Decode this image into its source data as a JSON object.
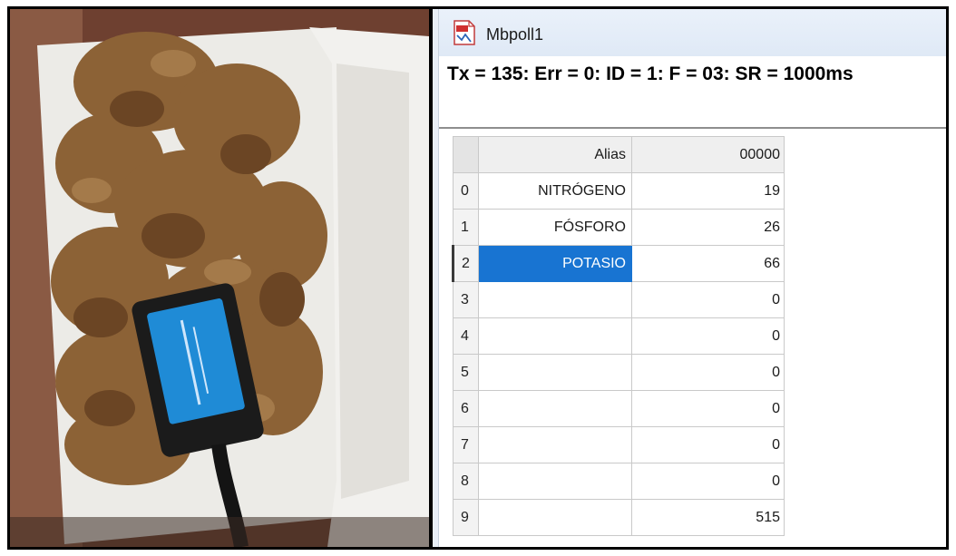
{
  "window": {
    "title": "Mbpoll1",
    "status_line": "Tx = 135: Err = 0: ID = 1: F = 03: SR = 1000ms"
  },
  "grid": {
    "header": {
      "alias": "Alias",
      "value": "00000"
    },
    "selected_row": 2,
    "rows": [
      {
        "index": "0",
        "alias": "NITRÓGENO",
        "value": "19"
      },
      {
        "index": "1",
        "alias": "FÓSFORO",
        "value": "26"
      },
      {
        "index": "2",
        "alias": "POTASIO",
        "value": "66"
      },
      {
        "index": "3",
        "alias": "",
        "value": "0"
      },
      {
        "index": "4",
        "alias": "",
        "value": "0"
      },
      {
        "index": "5",
        "alias": "",
        "value": "0"
      },
      {
        "index": "6",
        "alias": "",
        "value": "0"
      },
      {
        "index": "7",
        "alias": "",
        "value": "0"
      },
      {
        "index": "8",
        "alias": "",
        "value": "0"
      },
      {
        "index": "9",
        "alias": "",
        "value": "515"
      }
    ]
  },
  "colors": {
    "selection": "#1874d2",
    "titlebar": "#e3ecf7",
    "sensor_body": "#1f8bd6"
  },
  "icons": {
    "app": "mbpoll-app-icon"
  }
}
